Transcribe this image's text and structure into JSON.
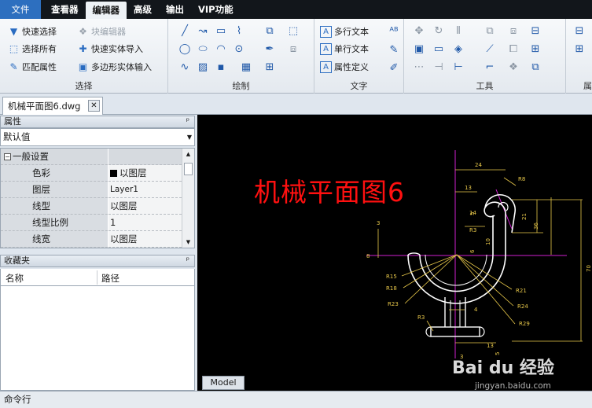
{
  "menu": {
    "file": "文件",
    "items": [
      "查看器",
      "编辑器",
      "高级",
      "输出",
      "VIP功能"
    ],
    "active_index": 1
  },
  "ribbon": {
    "select": {
      "label": "选择",
      "quick_select": "快速选择",
      "block_editor": "块编辑器",
      "select_all": "选择所有",
      "quick_solid_import": "快速实体导入",
      "match_props": "匹配属性",
      "polygon_solid_input": "多边形实体输入"
    },
    "draw": {
      "label": "绘制"
    },
    "text": {
      "label": "文字",
      "mtext": "多行文本",
      "stext": "单行文本",
      "attdef": "属性定义"
    },
    "tools": {
      "label": "工具"
    },
    "partial_label": "属"
  },
  "doc_tab": {
    "name": "机械平面图6.dwg",
    "close": "✕"
  },
  "properties": {
    "title": "属性",
    "pin": "ᵖ",
    "dropdown_value": "默认值",
    "group": "一般设置",
    "rows": [
      {
        "key": "色彩",
        "value": "以图层",
        "swatch": true
      },
      {
        "key": "图层",
        "value": "Layer1"
      },
      {
        "key": "线型",
        "value": "以图层"
      },
      {
        "key": "线型比例",
        "value": "1"
      },
      {
        "key": "线宽",
        "value": "以图层"
      }
    ]
  },
  "favorites": {
    "title": "收藏夹",
    "col_name": "名称",
    "col_path": "路径"
  },
  "canvas": {
    "title": "机械平面图6",
    "model_tab": "Model",
    "dims": {
      "d24": "24",
      "d13": "13",
      "d5": "5",
      "d14": "14",
      "d3a": "3",
      "r3": "R3",
      "d10": "10",
      "d6": "6",
      "d21": "21",
      "d36": "36",
      "d70": "70",
      "r8": "R8",
      "r15": "R15",
      "r18": "R18",
      "r23": "R23",
      "r21": "R21",
      "r24": "R24",
      "r29": "R29",
      "r3b": "R3",
      "d4": "4",
      "d13b": "13",
      "d5b": "5",
      "d8": "8",
      "d3b": "3"
    },
    "watermark": "Bai du 经验",
    "watermark_url": "jingyan.baidu.com"
  },
  "command": {
    "label": "命令行"
  },
  "colors": {
    "menubar": "#12161b",
    "file_button": "#2d6fbf",
    "canvas_bg": "#000000",
    "title_red": "#ff1010",
    "drawing_white": "#ffffff",
    "dimension_yellow": "#e8c84a",
    "centerline_magenta": "#d020d0"
  }
}
